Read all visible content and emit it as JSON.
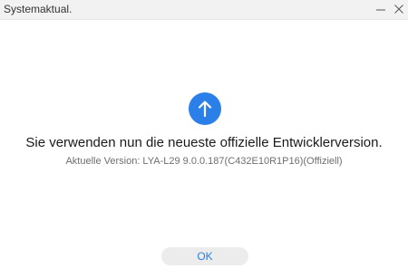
{
  "window": {
    "title": "Systemaktual."
  },
  "icons": {
    "minimize": "minimize-icon",
    "close": "close-icon",
    "status": "arrow-up-icon"
  },
  "colors": {
    "accent": "#2b7fe8",
    "button_bg": "#ececec",
    "titlebar_bg": "#f2f2f2"
  },
  "content": {
    "message": "Sie verwenden nun die neueste offizielle Entwicklerversion.",
    "version_text": "Aktuelle Version: LYA-L29 9.0.0.187(C432E10R1P16)(Offiziell)"
  },
  "actions": {
    "ok_label": "OK"
  }
}
